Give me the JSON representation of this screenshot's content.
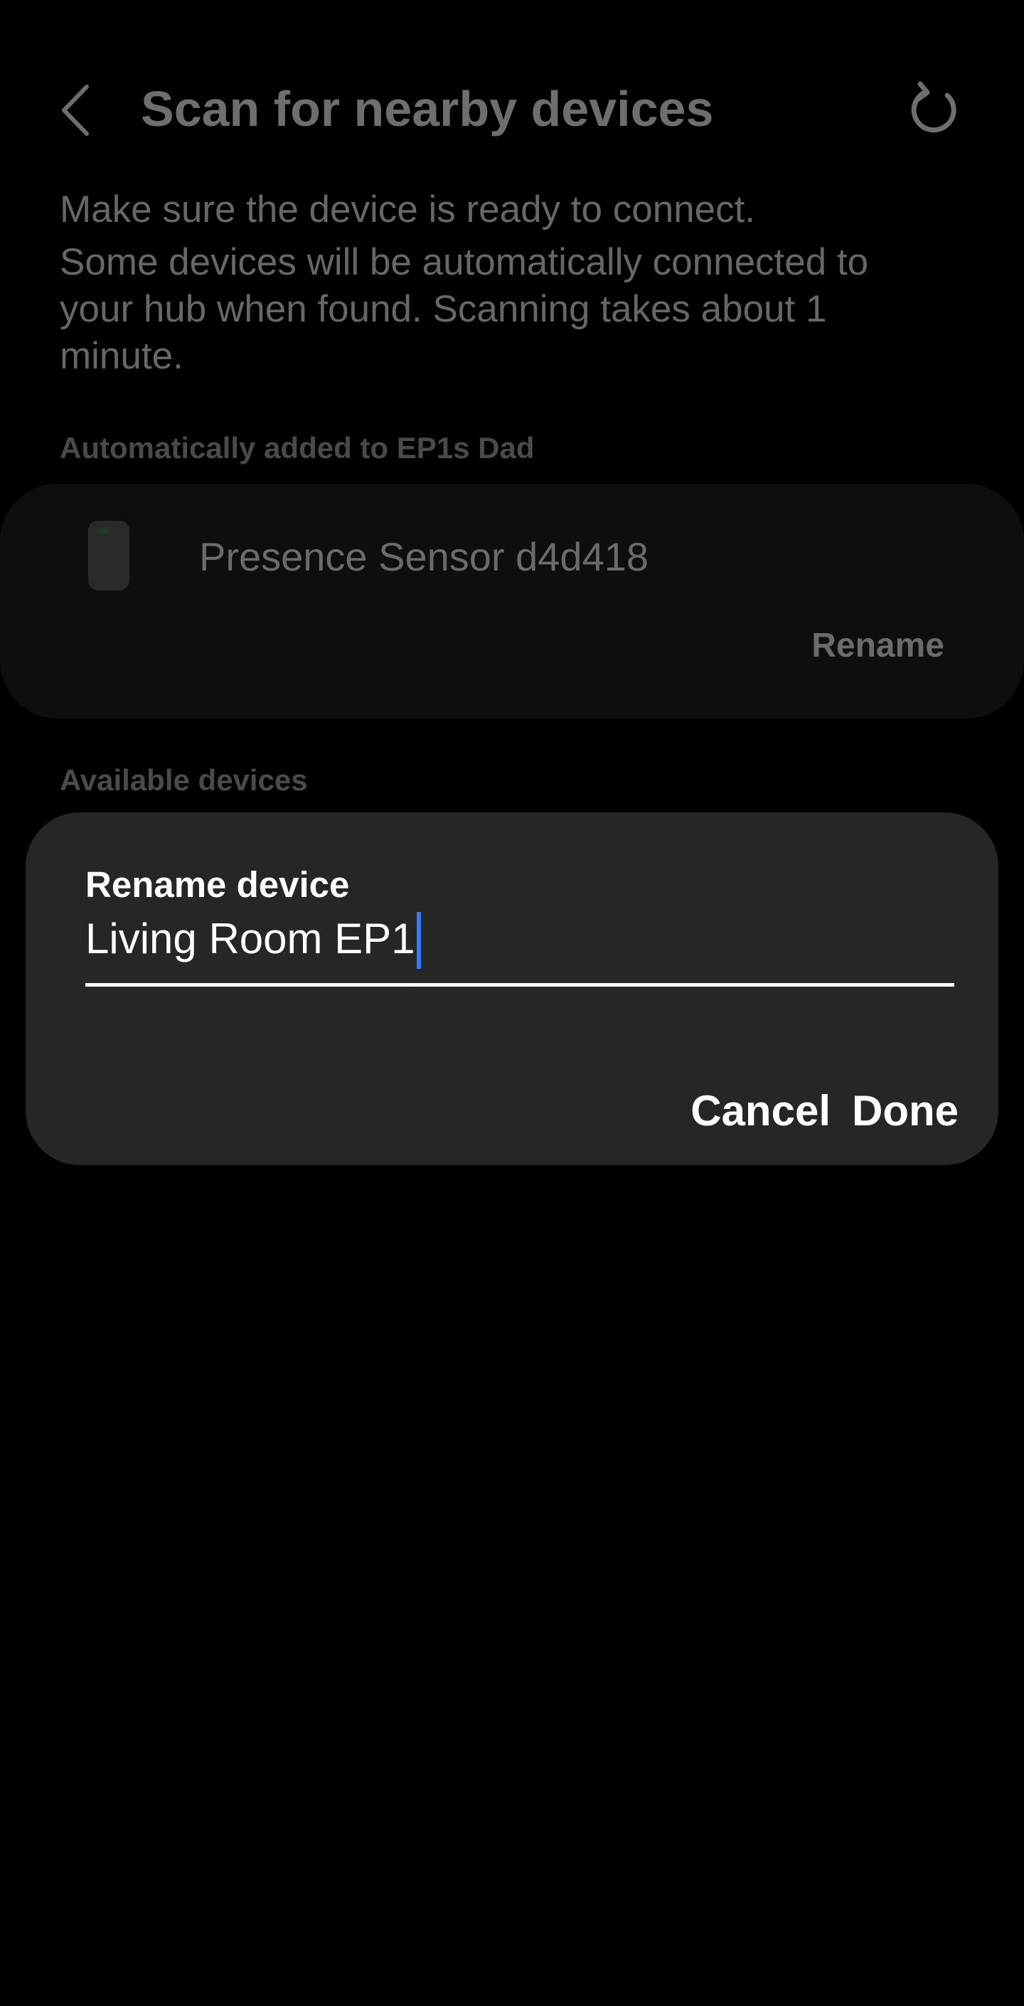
{
  "header": {
    "back_icon": "chevron-left-icon",
    "title": "Scan for nearby devices",
    "refresh_icon": "refresh-icon"
  },
  "intro": {
    "line1": "Make sure the device is ready to connect.",
    "line2": "Some devices will be automatically connected to your hub when found. Scanning takes about 1 minute."
  },
  "sections": {
    "auto_added_label": "Automatically added to EP1s Dad",
    "available_label": "Available devices"
  },
  "device": {
    "icon": "presence-sensor-icon",
    "name": "Presence Sensor d4d418",
    "rename_label": "Rename"
  },
  "dialog": {
    "title": "Rename device",
    "input_value": "Living Room EP1",
    "cancel_label": "Cancel",
    "done_label": "Done"
  },
  "colors": {
    "background": "#000000",
    "card": "#0e0e0e",
    "dialog": "#262626",
    "caret": "#2f7dff",
    "dimmed_text": "#6b6b6b"
  }
}
